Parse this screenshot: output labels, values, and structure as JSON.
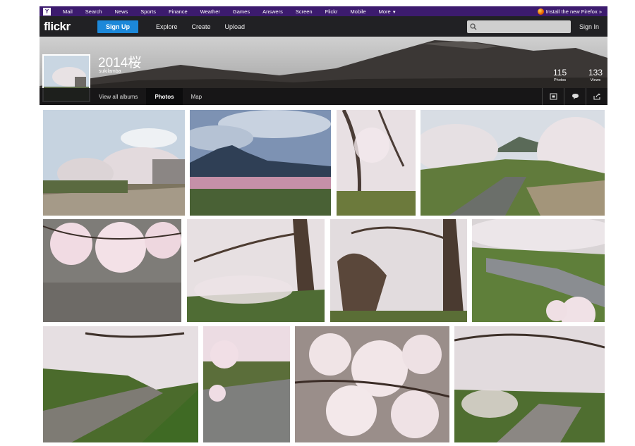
{
  "yahoo_bar": {
    "links": [
      "Mail",
      "Search",
      "News",
      "Sports",
      "Finance",
      "Weather",
      "Games",
      "Answers",
      "Screen",
      "Flickr",
      "Mobile"
    ],
    "more_label": "More",
    "firefox_label": "Install the new Firefox »"
  },
  "header": {
    "logo": "flickr",
    "signup_label": "Sign Up",
    "nav": [
      "Explore",
      "Create",
      "Upload"
    ],
    "search_placeholder": "",
    "signin_label": "Sign In"
  },
  "album": {
    "title": "2014桜",
    "owner": "sukilamba",
    "photos_count": "115",
    "photos_label": "Photos",
    "views_count": "133",
    "views_label": "Views"
  },
  "subnav": {
    "tabs": [
      "View all albums",
      "Photos",
      "Map"
    ],
    "active_tab": "Photos"
  },
  "photos": [
    {
      "alt": "blossoming cherry tree by house"
    },
    {
      "alt": "mountain behind cherry trees"
    },
    {
      "alt": "cherry blossoms over grass"
    },
    {
      "alt": "cherry trees along creek"
    },
    {
      "alt": "blossom branch over water"
    },
    {
      "alt": "cherry tree trunk arch"
    },
    {
      "alt": "large cherry tree trunk"
    },
    {
      "alt": "creek with blossoms"
    },
    {
      "alt": "blossoms over creek bank"
    },
    {
      "alt": "blossom branch above stream"
    },
    {
      "alt": "close-up cherry blossoms"
    },
    {
      "alt": "cherry trees arching over creek"
    }
  ]
}
